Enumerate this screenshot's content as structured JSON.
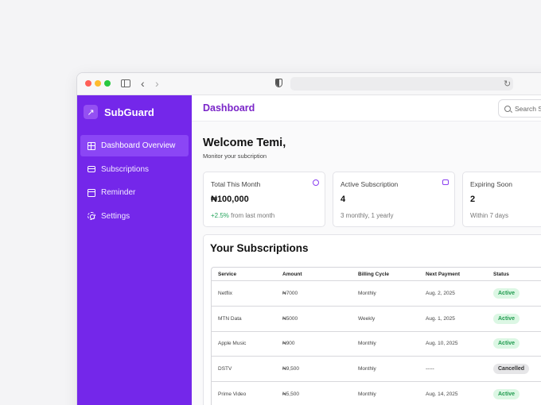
{
  "app": {
    "brand": "SubGuard",
    "page_title": "Dashboard"
  },
  "sidebar": {
    "items": [
      {
        "label": "Dashboard Overview",
        "icon": "grid-icon",
        "active": true
      },
      {
        "label": "Subscriptions",
        "icon": "card-icon"
      },
      {
        "label": "Reminder",
        "icon": "calendar-icon"
      },
      {
        "label": "Settings",
        "icon": "gear-icon"
      }
    ]
  },
  "search": {
    "placeholder": "Search Su"
  },
  "welcome": {
    "title": "Welcome Temi,",
    "subtitle": "Monitor your subcription"
  },
  "cards": [
    {
      "label": "Total This Month",
      "value": "₦100,000",
      "note_up": "+2.5%",
      "note": " from last month",
      "icon": "currency-icon"
    },
    {
      "label": "Active Subscription",
      "value": "4",
      "note": "3 monthly, 1 yearly",
      "icon": "card-icon"
    },
    {
      "label": "Expiring Soon",
      "value": "2",
      "note": "Within 7 days"
    }
  ],
  "subscriptions": {
    "title": "Your Subscriptions",
    "columns": [
      "Service",
      "Amount",
      "Billing Cycle",
      "Next Payment",
      "Status"
    ],
    "rows": [
      [
        "Netflix",
        "₦7000",
        "Monthly",
        "Aug. 2, 2025",
        "Active"
      ],
      [
        "MTN Data",
        "₦5000",
        "Weekly",
        "Aug. 1, 2025",
        "Active"
      ],
      [
        "Apple Music",
        "₦900",
        "Monthly",
        "Aug. 10, 2025",
        "Active"
      ],
      [
        "DSTV",
        "₦9,500",
        "Monthly",
        "-----",
        "Cancelled"
      ],
      [
        "Prime Video",
        "₦5,500",
        "Monthly",
        "Aug. 14, 2025",
        "Active"
      ]
    ]
  },
  "colors": {
    "sidebar": "#7427ea",
    "accent": "#7a25c8",
    "active_green": "#1f9a4e"
  }
}
